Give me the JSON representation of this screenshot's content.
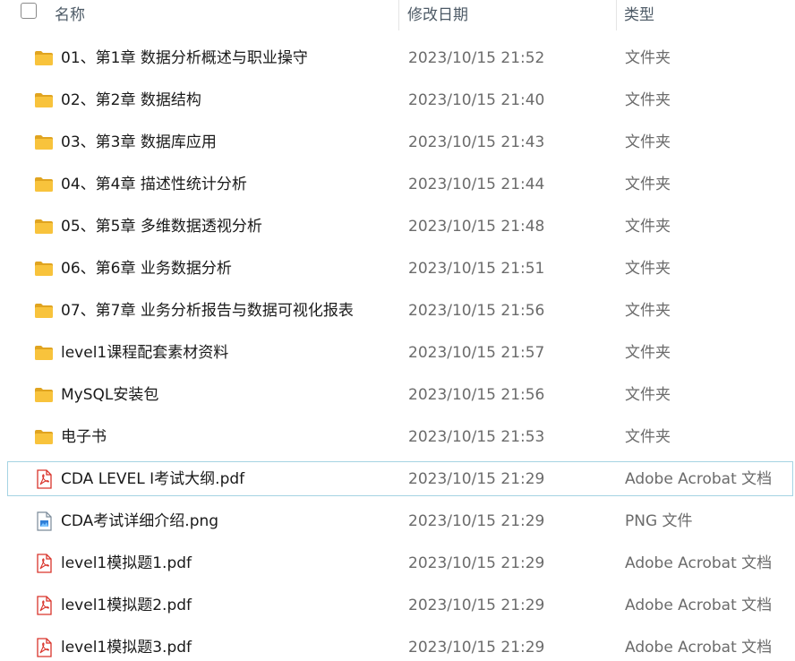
{
  "header": {
    "name": "名称",
    "date": "修改日期",
    "type": "类型"
  },
  "files": [
    {
      "name": "01、第1章 数据分析概述与职业操守",
      "date": "2023/10/15 21:52",
      "type": "文件夹",
      "icon": "folder-icon"
    },
    {
      "name": "02、第2章 数据结构",
      "date": "2023/10/15 21:40",
      "type": "文件夹",
      "icon": "folder-icon"
    },
    {
      "name": "03、第3章 数据库应用",
      "date": "2023/10/15 21:43",
      "type": "文件夹",
      "icon": "folder-icon"
    },
    {
      "name": "04、第4章 描述性统计分析",
      "date": "2023/10/15 21:44",
      "type": "文件夹",
      "icon": "folder-icon"
    },
    {
      "name": "05、第5章 多维数据透视分析",
      "date": "2023/10/15 21:48",
      "type": "文件夹",
      "icon": "folder-icon"
    },
    {
      "name": "06、第6章 业务数据分析",
      "date": "2023/10/15 21:51",
      "type": "文件夹",
      "icon": "folder-icon"
    },
    {
      "name": "07、第7章 业务分析报告与数据可视化报表",
      "date": "2023/10/15 21:56",
      "type": "文件夹",
      "icon": "folder-icon"
    },
    {
      "name": "level1课程配套素材资料",
      "date": "2023/10/15 21:57",
      "type": "文件夹",
      "icon": "folder-icon"
    },
    {
      "name": "MySQL安装包",
      "date": "2023/10/15 21:56",
      "type": "文件夹",
      "icon": "folder-icon"
    },
    {
      "name": "电子书",
      "date": "2023/10/15 21:53",
      "type": "文件夹",
      "icon": "folder-icon"
    },
    {
      "name": "CDA LEVEL I考试大纲.pdf",
      "date": "2023/10/15 21:29",
      "type": "Adobe Acrobat 文档",
      "icon": "pdf-icon",
      "selected": true
    },
    {
      "name": "CDA考试详细介绍.png",
      "date": "2023/10/15 21:29",
      "type": "PNG 文件",
      "icon": "image-file-icon"
    },
    {
      "name": "level1模拟题1.pdf",
      "date": "2023/10/15 21:29",
      "type": "Adobe Acrobat 文档",
      "icon": "pdf-icon"
    },
    {
      "name": "level1模拟题2.pdf",
      "date": "2023/10/15 21:29",
      "type": "Adobe Acrobat 文档",
      "icon": "pdf-icon"
    },
    {
      "name": "level1模拟题3.pdf",
      "date": "2023/10/15 21:29",
      "type": "Adobe Acrobat 文档",
      "icon": "pdf-icon"
    }
  ],
  "colors": {
    "folder": "#f8c33c",
    "pdf": "#d9342b",
    "selection_border": "#a5d3e3"
  }
}
